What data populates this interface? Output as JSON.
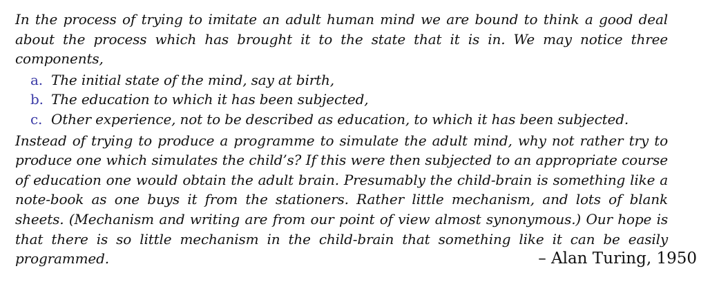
{
  "quote": {
    "intro": "In the process of trying to imitate an adult human mind we are bound to think a good deal about the process which has brought it to the state that it is in. We may notice three components,",
    "components": [
      {
        "marker": "a.",
        "text": "The initial state of the mind, say at birth,"
      },
      {
        "marker": "b.",
        "text": "The education to which it has been subjected,"
      },
      {
        "marker": "c.",
        "text": "Other experience, not to be described as education, to which it has been subjected."
      }
    ],
    "body": "Instead of trying to produce a programme to simulate the adult mind, why not rather try to produce one which simulates the child’s? If this were then subjected to an appropriate course of education one would obtain the adult brain. Presumably the child-brain is something like a note-book as one buys it from the stationers. Rather little mechanism, and lots of blank sheets. (Mechanism and writing are from our point of view almost synonymous.) Our hope is that there is so little mechanism in the child-brain that something like it can be easily programmed."
  },
  "attribution": "– Alan Turing, 1950",
  "colors": {
    "text": "#111111",
    "list_marker": "#3a3aa6",
    "background": "#ffffff"
  }
}
